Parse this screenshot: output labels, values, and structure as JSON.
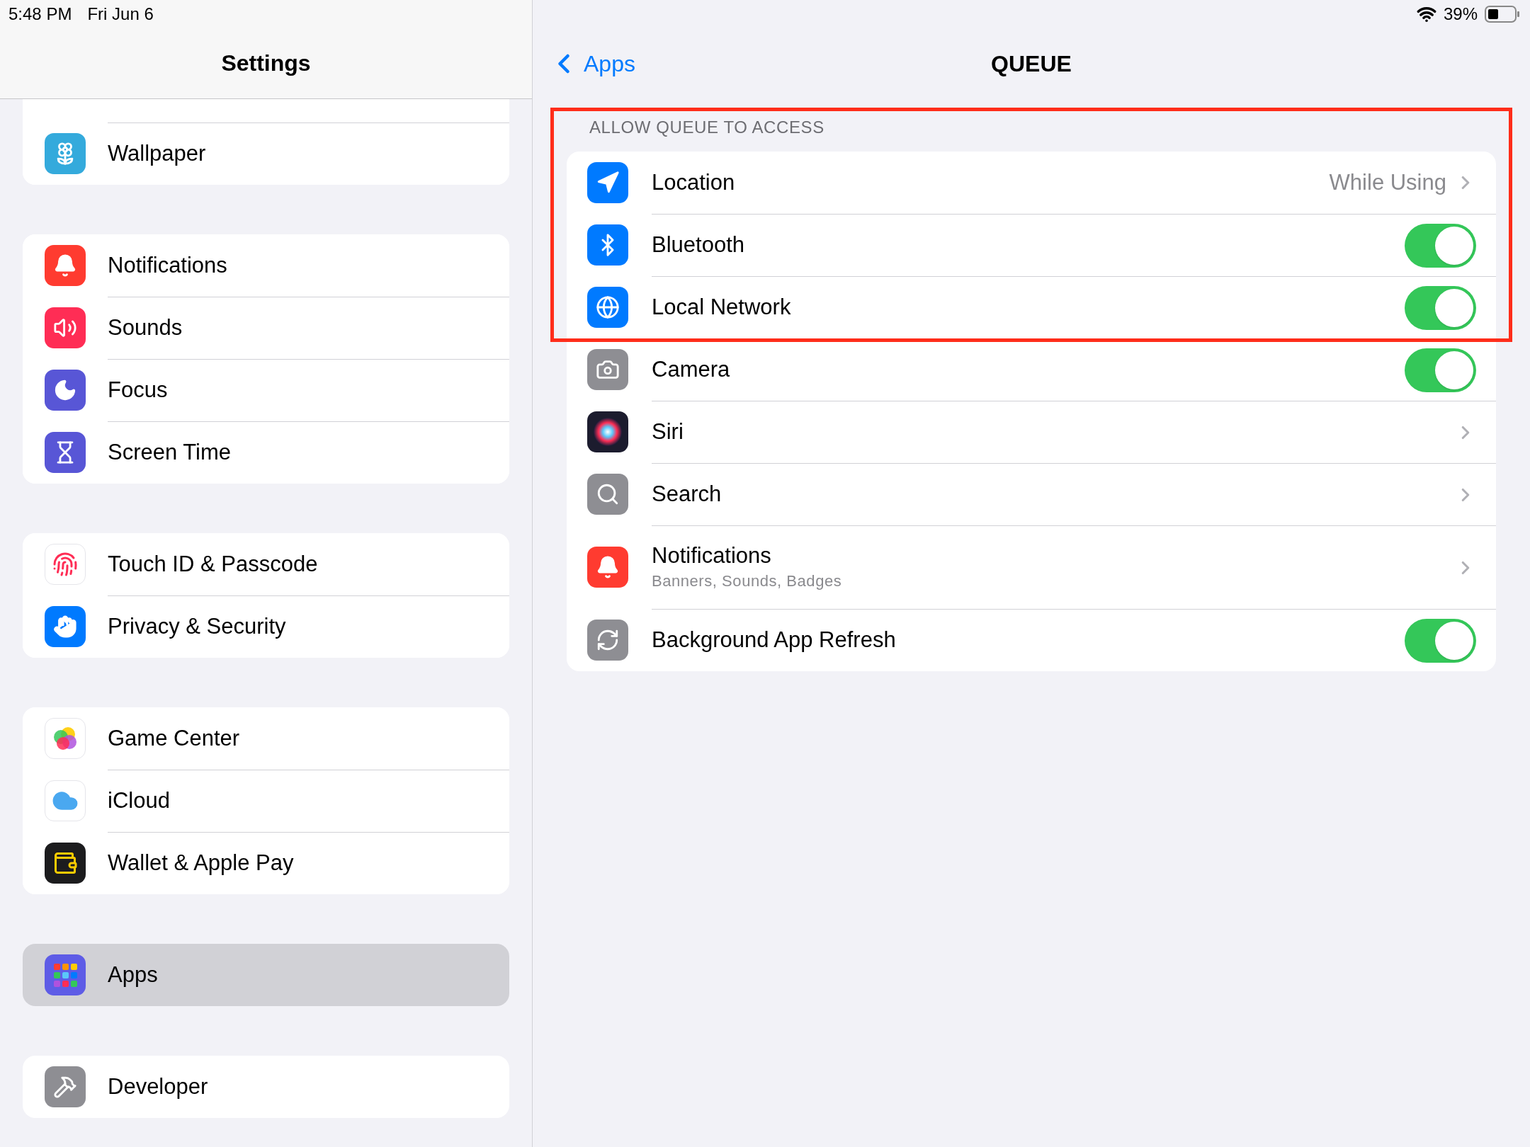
{
  "status_bar": {
    "time": "5:48 PM",
    "date": "Fri Jun 6",
    "battery": "39%"
  },
  "sidebar": {
    "title": "Settings",
    "groups": [
      {
        "items": [
          {
            "label": "Wallpaper",
            "selected": false
          }
        ]
      },
      {
        "items": [
          {
            "label": "Notifications",
            "selected": false
          },
          {
            "label": "Sounds",
            "selected": false
          },
          {
            "label": "Focus",
            "selected": false
          },
          {
            "label": "Screen Time",
            "selected": false
          }
        ]
      },
      {
        "items": [
          {
            "label": "Touch ID & Passcode",
            "selected": false
          },
          {
            "label": "Privacy & Security",
            "selected": false
          }
        ]
      },
      {
        "items": [
          {
            "label": "Game Center",
            "selected": false
          },
          {
            "label": "iCloud",
            "selected": false
          },
          {
            "label": "Wallet & Apple Pay",
            "selected": false
          }
        ]
      },
      {
        "items": [
          {
            "label": "Apps",
            "selected": true
          }
        ]
      },
      {
        "items": [
          {
            "label": "Developer",
            "selected": false
          }
        ]
      }
    ]
  },
  "detail": {
    "back": "Apps",
    "title": "QUEUE",
    "section_header": "ALLOW QUEUE TO ACCESS",
    "rows": [
      {
        "label": "Location",
        "kind": "value",
        "value": "While Using",
        "highlighted": true
      },
      {
        "label": "Bluetooth",
        "kind": "toggle",
        "on": true,
        "highlighted": true
      },
      {
        "label": "Local Network",
        "kind": "toggle",
        "on": true,
        "highlighted": true
      },
      {
        "label": "Camera",
        "kind": "toggle",
        "on": true,
        "highlighted": false
      },
      {
        "label": "Siri",
        "kind": "link",
        "highlighted": false
      },
      {
        "label": "Search",
        "kind": "link",
        "highlighted": false
      },
      {
        "label": "Notifications",
        "kind": "link",
        "subtitle": "Banners, Sounds, Badges",
        "highlighted": false
      },
      {
        "label": "Background App Refresh",
        "kind": "toggle",
        "on": true,
        "highlighted": false
      }
    ]
  }
}
